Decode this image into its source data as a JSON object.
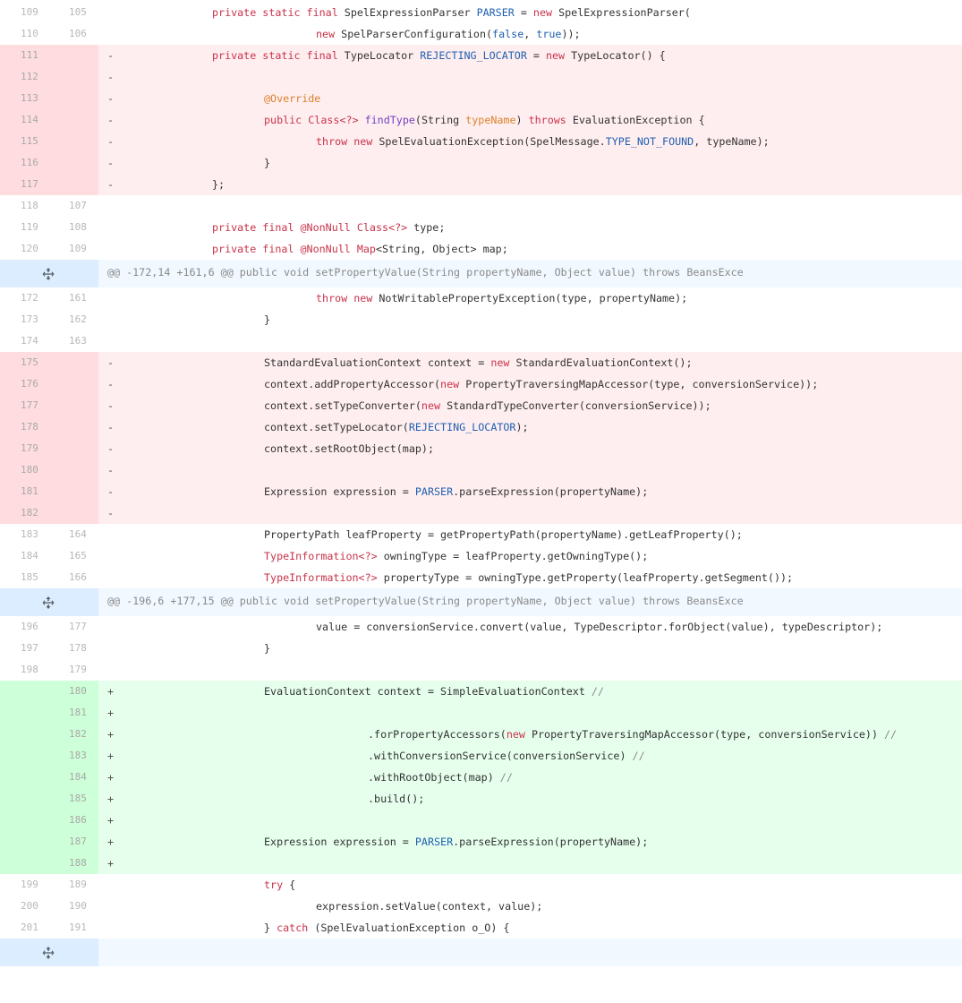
{
  "diff": {
    "rows": [
      {
        "type": "ctx",
        "old": "109",
        "new": "105",
        "marker": "",
        "indent": 0,
        "tokens": [
          [
            "kw",
            "private static final "
          ],
          [
            "",
            "SpelExpressionParser "
          ],
          [
            "cn",
            "PARSER"
          ],
          [
            "",
            " = "
          ],
          [
            "kw",
            "new "
          ],
          [
            "",
            "SpelExpressionParser("
          ]
        ]
      },
      {
        "type": "ctx",
        "old": "110",
        "new": "106",
        "marker": "",
        "indent": 2,
        "tokens": [
          [
            "kw",
            "new "
          ],
          [
            "",
            "SpelParserConfiguration("
          ],
          [
            "cn",
            "false"
          ],
          [
            "",
            ", "
          ],
          [
            "cn",
            "true"
          ],
          [
            "",
            "));"
          ]
        ]
      },
      {
        "type": "del",
        "old": "111",
        "new": "",
        "marker": "-",
        "indent": 0,
        "tokens": [
          [
            "kw",
            "private static final "
          ],
          [
            "",
            "TypeLocator "
          ],
          [
            "cn",
            "REJECTING_LOCATOR"
          ],
          [
            "",
            " = "
          ],
          [
            "kw",
            "new "
          ],
          [
            "",
            "TypeLocator() {"
          ]
        ]
      },
      {
        "type": "del",
        "old": "112",
        "new": "",
        "marker": "-",
        "indent": 0,
        "tokens": []
      },
      {
        "type": "del",
        "old": "113",
        "new": "",
        "marker": "-",
        "indent": 1,
        "tokens": [
          [
            "pm",
            "@Override"
          ]
        ]
      },
      {
        "type": "del",
        "old": "114",
        "new": "",
        "marker": "-",
        "indent": 1,
        "tokens": [
          [
            "kw",
            "public "
          ],
          [
            "ty",
            "Class<?> "
          ],
          [
            "fn",
            "findType"
          ],
          [
            "",
            "(String "
          ],
          [
            "pm",
            "typeName"
          ],
          [
            "",
            ") "
          ],
          [
            "kw",
            "throws "
          ],
          [
            "",
            "EvaluationException {"
          ]
        ]
      },
      {
        "type": "del",
        "old": "115",
        "new": "",
        "marker": "-",
        "indent": 2,
        "tokens": [
          [
            "kw",
            "throw new "
          ],
          [
            "",
            "SpelEvaluationException(SpelMessage."
          ],
          [
            "cn",
            "TYPE_NOT_FOUND"
          ],
          [
            "",
            ", typeName);"
          ]
        ]
      },
      {
        "type": "del",
        "old": "116",
        "new": "",
        "marker": "-",
        "indent": 1,
        "tokens": [
          [
            "",
            "}"
          ]
        ]
      },
      {
        "type": "del",
        "old": "117",
        "new": "",
        "marker": "-",
        "indent": 0,
        "tokens": [
          [
            "",
            "};"
          ]
        ]
      },
      {
        "type": "ctx",
        "old": "118",
        "new": "107",
        "marker": "",
        "indent": 0,
        "tokens": []
      },
      {
        "type": "ctx",
        "old": "119",
        "new": "108",
        "marker": "",
        "indent": 0,
        "tokens": [
          [
            "kw",
            "private final @NonNull "
          ],
          [
            "ty",
            "Class<?> "
          ],
          [
            "",
            "type;"
          ]
        ]
      },
      {
        "type": "ctx",
        "old": "120",
        "new": "109",
        "marker": "",
        "indent": 0,
        "tokens": [
          [
            "kw",
            "private final @NonNull "
          ],
          [
            "ty",
            "Map"
          ],
          [
            "",
            "<String, Object> map;"
          ]
        ]
      },
      {
        "type": "hunk",
        "text": "@@ -172,14 +161,6 @@ public void setPropertyValue(String propertyName, Object value) throws BeansExce"
      },
      {
        "type": "ctx",
        "old": "172",
        "new": "161",
        "marker": "",
        "indent": 2,
        "tokens": [
          [
            "kw",
            "throw new "
          ],
          [
            "",
            "NotWritablePropertyException(type, propertyName);"
          ]
        ]
      },
      {
        "type": "ctx",
        "old": "173",
        "new": "162",
        "marker": "",
        "indent": 1,
        "tokens": [
          [
            "",
            "}"
          ]
        ]
      },
      {
        "type": "ctx",
        "old": "174",
        "new": "163",
        "marker": "",
        "indent": 0,
        "tokens": []
      },
      {
        "type": "del",
        "old": "175",
        "new": "",
        "marker": "-",
        "indent": 1,
        "tokens": [
          [
            "",
            "StandardEvaluationContext context = "
          ],
          [
            "kw",
            "new "
          ],
          [
            "",
            "StandardEvaluationContext();"
          ]
        ]
      },
      {
        "type": "del",
        "old": "176",
        "new": "",
        "marker": "-",
        "indent": 1,
        "tokens": [
          [
            "",
            "context.addPropertyAccessor("
          ],
          [
            "kw",
            "new "
          ],
          [
            "",
            "PropertyTraversingMapAccessor(type, conversionService));"
          ]
        ]
      },
      {
        "type": "del",
        "old": "177",
        "new": "",
        "marker": "-",
        "indent": 1,
        "tokens": [
          [
            "",
            "context.setTypeConverter("
          ],
          [
            "kw",
            "new "
          ],
          [
            "",
            "StandardTypeConverter(conversionService));"
          ]
        ]
      },
      {
        "type": "del",
        "old": "178",
        "new": "",
        "marker": "-",
        "indent": 1,
        "tokens": [
          [
            "",
            "context.setTypeLocator("
          ],
          [
            "cn",
            "REJECTING_LOCATOR"
          ],
          [
            "",
            ");"
          ]
        ]
      },
      {
        "type": "del",
        "old": "179",
        "new": "",
        "marker": "-",
        "indent": 1,
        "tokens": [
          [
            "",
            "context.setRootObject(map);"
          ]
        ]
      },
      {
        "type": "del",
        "old": "180",
        "new": "",
        "marker": "-",
        "indent": 0,
        "tokens": []
      },
      {
        "type": "del",
        "old": "181",
        "new": "",
        "marker": "-",
        "indent": 1,
        "tokens": [
          [
            "",
            "Expression expression = "
          ],
          [
            "cn",
            "PARSER"
          ],
          [
            "",
            ".parseExpression(propertyName);"
          ]
        ]
      },
      {
        "type": "del",
        "old": "182",
        "new": "",
        "marker": "-",
        "indent": 0,
        "tokens": []
      },
      {
        "type": "ctx",
        "old": "183",
        "new": "164",
        "marker": "",
        "indent": 1,
        "tokens": [
          [
            "",
            "PropertyPath leafProperty = getPropertyPath(propertyName).getLeafProperty();"
          ]
        ]
      },
      {
        "type": "ctx",
        "old": "184",
        "new": "165",
        "marker": "",
        "indent": 1,
        "tokens": [
          [
            "ty",
            "TypeInformation<?> "
          ],
          [
            "",
            "owningType = leafProperty.getOwningType();"
          ]
        ]
      },
      {
        "type": "ctx",
        "old": "185",
        "new": "166",
        "marker": "",
        "indent": 1,
        "tokens": [
          [
            "ty",
            "TypeInformation<?> "
          ],
          [
            "",
            "propertyType = owningType.getProperty(leafProperty.getSegment());"
          ]
        ]
      },
      {
        "type": "hunk",
        "text": "@@ -196,6 +177,15 @@ public void setPropertyValue(String propertyName, Object value) throws BeansExce"
      },
      {
        "type": "ctx",
        "old": "196",
        "new": "177",
        "marker": "",
        "indent": 2,
        "tokens": [
          [
            "",
            "value = conversionService.convert(value, TypeDescriptor.forObject(value), typeDescriptor);"
          ]
        ]
      },
      {
        "type": "ctx",
        "old": "197",
        "new": "178",
        "marker": "",
        "indent": 1,
        "tokens": [
          [
            "",
            "}"
          ]
        ]
      },
      {
        "type": "ctx",
        "old": "198",
        "new": "179",
        "marker": "",
        "indent": 0,
        "tokens": []
      },
      {
        "type": "add",
        "old": "",
        "new": "180",
        "marker": "+",
        "indent": 1,
        "tokens": [
          [
            "",
            "EvaluationContext context = SimpleEvaluationContext "
          ],
          [
            "cm",
            "//"
          ]
        ]
      },
      {
        "type": "add",
        "old": "",
        "new": "181",
        "marker": "+",
        "indent": 0,
        "tokens": []
      },
      {
        "type": "add",
        "old": "",
        "new": "182",
        "marker": "+",
        "indent": 3,
        "tokens": [
          [
            "",
            ".forPropertyAccessors("
          ],
          [
            "kw",
            "new "
          ],
          [
            "",
            "PropertyTraversingMapAccessor(type, conversionService)) "
          ],
          [
            "cm",
            "//"
          ]
        ]
      },
      {
        "type": "add",
        "old": "",
        "new": "183",
        "marker": "+",
        "indent": 3,
        "tokens": [
          [
            "",
            ".withConversionService(conversionService) "
          ],
          [
            "cm",
            "//"
          ]
        ]
      },
      {
        "type": "add",
        "old": "",
        "new": "184",
        "marker": "+",
        "indent": 3,
        "tokens": [
          [
            "",
            ".withRootObject(map) "
          ],
          [
            "cm",
            "//"
          ]
        ]
      },
      {
        "type": "add",
        "old": "",
        "new": "185",
        "marker": "+",
        "indent": 3,
        "tokens": [
          [
            "",
            ".build();"
          ]
        ]
      },
      {
        "type": "add",
        "old": "",
        "new": "186",
        "marker": "+",
        "indent": 0,
        "tokens": []
      },
      {
        "type": "add",
        "old": "",
        "new": "187",
        "marker": "+",
        "indent": 1,
        "tokens": [
          [
            "",
            "Expression expression = "
          ],
          [
            "cn",
            "PARSER"
          ],
          [
            "",
            ".parseExpression(propertyName);"
          ]
        ]
      },
      {
        "type": "add",
        "old": "",
        "new": "188",
        "marker": "+",
        "indent": 0,
        "tokens": []
      },
      {
        "type": "ctx",
        "old": "199",
        "new": "189",
        "marker": "",
        "indent": 1,
        "tokens": [
          [
            "kw",
            "try "
          ],
          [
            "",
            "{"
          ]
        ]
      },
      {
        "type": "ctx",
        "old": "200",
        "new": "190",
        "marker": "",
        "indent": 2,
        "tokens": [
          [
            "",
            "expression.setValue(context, value);"
          ]
        ]
      },
      {
        "type": "ctx",
        "old": "201",
        "new": "191",
        "marker": "",
        "indent": 1,
        "tokens": [
          [
            "",
            "} "
          ],
          [
            "kw",
            "catch "
          ],
          [
            "",
            "(SpelEvaluationException o_O) {"
          ]
        ]
      },
      {
        "type": "hunk",
        "text": ""
      }
    ],
    "icons": {
      "expand": "unfold-icon"
    },
    "colors": {
      "deleted_gutter": "#ffdce0",
      "deleted_line": "#ffeef0",
      "added_gutter": "#cdffd8",
      "added_line": "#e6ffed",
      "hunk_gutter": "#dbedff",
      "hunk_line": "#f1f8ff"
    }
  }
}
